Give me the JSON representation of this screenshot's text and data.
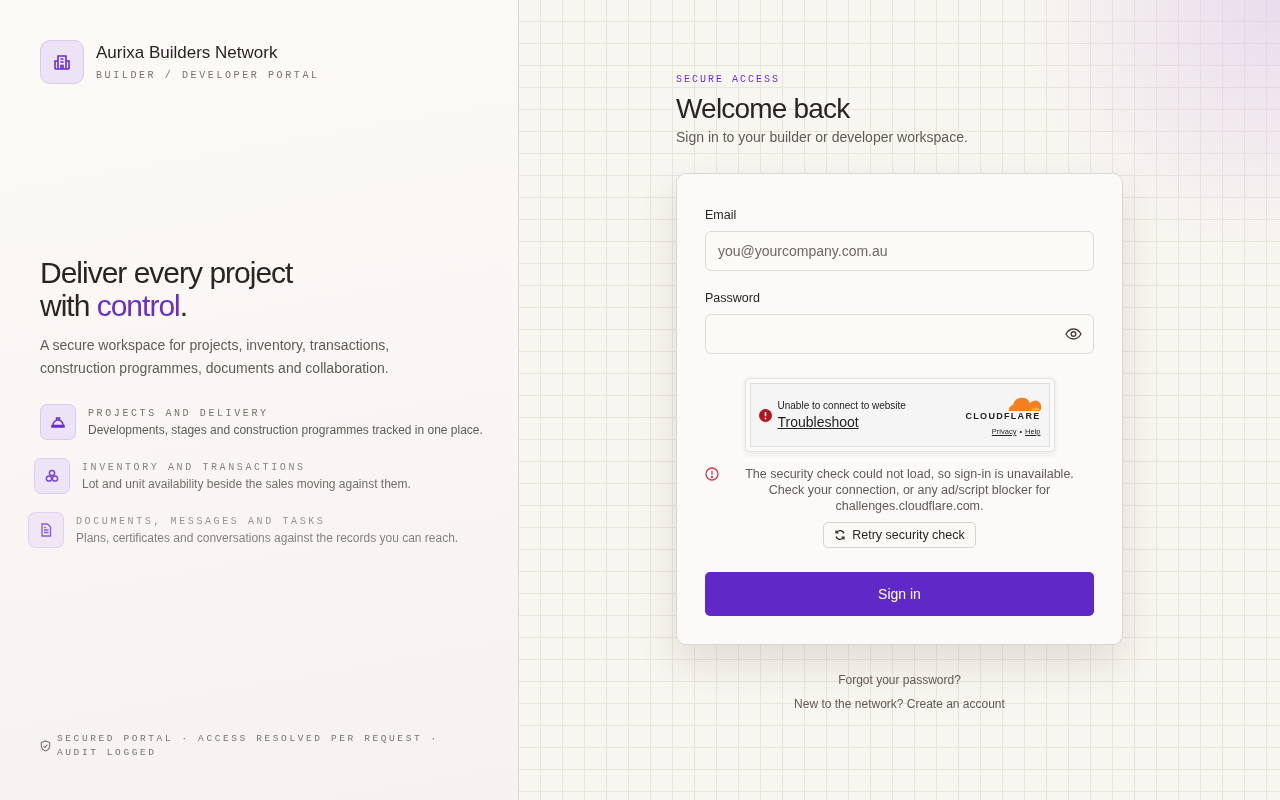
{
  "brand": {
    "name": "Aurixa Builders Network",
    "tagline": "BUILDER / DEVELOPER PORTAL"
  },
  "hero": {
    "line_1": "Deliver every project",
    "line_2_before": "with ",
    "line_2_accent": "control",
    "line_2_after": ".",
    "description": "A secure workspace for projects, inventory, transactions, construction programmes, documents and collaboration."
  },
  "features": [
    {
      "kind": "helmet",
      "title": "PROJECTS AND DELIVERY",
      "text": "Developments, stages and construction programmes tracked in one place."
    },
    {
      "kind": "cubes",
      "title": "INVENTORY AND TRANSACTIONS",
      "text": "Lot and unit availability beside the sales moving against them."
    },
    {
      "kind": "document",
      "title": "DOCUMENTS, MESSAGES AND TASKS",
      "text": "Plans, certificates and conversations against the records you can reach."
    }
  ],
  "footer": "SECURED PORTAL · ACCESS RESOLVED PER REQUEST · AUDIT LOGGED",
  "login": {
    "eyebrow": "SECURE ACCESS",
    "title": "Welcome back",
    "subtitle": "Sign in to your builder or developer workspace.",
    "email": {
      "label": "Email",
      "placeholder": "you@yourcompany.com.au"
    },
    "password": {
      "label": "Password"
    },
    "captcha": {
      "message": "Unable to connect to website",
      "link": "Troubleshoot",
      "brand": "CLOUDFLARE",
      "privacy": "Privacy",
      "separator": "•",
      "help": "Help"
    },
    "error": "The security check could not load, so sign-in is unavailable. Check your connection, or any ad/script blocker for challenges.cloudflare.com.",
    "retry": "Retry security check",
    "submit": "Sign in",
    "forgot": "Forgot your password?",
    "signup": "New to the network? Create an account"
  }
}
